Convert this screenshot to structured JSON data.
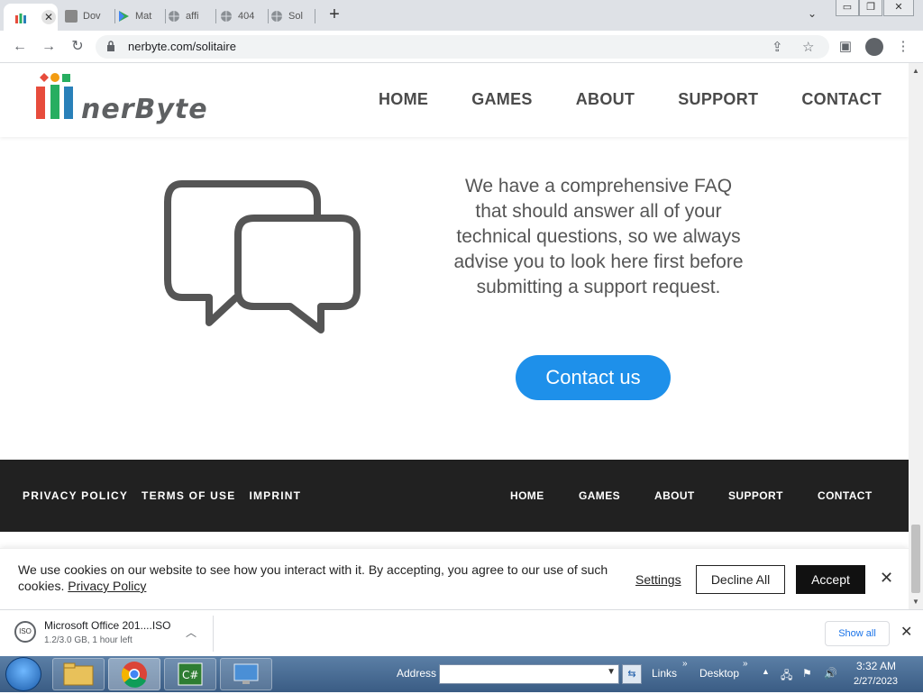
{
  "browser": {
    "tabs": [
      {
        "label": "",
        "icon": "nerbyte-favicon",
        "active": true
      },
      {
        "label": "Dov",
        "icon": "download-favicon"
      },
      {
        "label": "Mat",
        "icon": "play-store-favicon"
      },
      {
        "label": "affi",
        "icon": "globe-favicon"
      },
      {
        "label": "404",
        "icon": "globe-favicon"
      },
      {
        "label": "Sol",
        "icon": "globe-favicon"
      }
    ],
    "url": "nerbyte.com/solitaire"
  },
  "site": {
    "logo_text": "nerByte",
    "nav": [
      "HOME",
      "GAMES",
      "ABOUT",
      "SUPPORT",
      "CONTACT"
    ],
    "faq_text": "We have a comprehensive FAQ that should answer all of your technical questions, so we always advise you to look here first before submitting a support request.",
    "contact_button": "Contact us",
    "footer_left": [
      "PRIVACY POLICY",
      "TERMS OF USE",
      "IMPRINT"
    ],
    "footer_right": [
      "HOME",
      "GAMES",
      "ABOUT",
      "SUPPORT",
      "CONTACT"
    ],
    "accent_color": "#1e90ea"
  },
  "cookie": {
    "text": "We use cookies on our website to see how you interact with it. By accepting, you agree to our use of such cookies.",
    "link": "Privacy Policy",
    "settings": "Settings",
    "decline": "Decline All",
    "accept": "Accept"
  },
  "download": {
    "name": "Microsoft Office 201....ISO",
    "status": "1.2/3.0 GB, 1 hour left",
    "show_all": "Show all",
    "file_badge": "ISO"
  },
  "taskbar": {
    "address_label": "Address",
    "links_label": "Links",
    "desktop_label": "Desktop",
    "time": "3:32 AM",
    "date": "2/27/2023"
  }
}
